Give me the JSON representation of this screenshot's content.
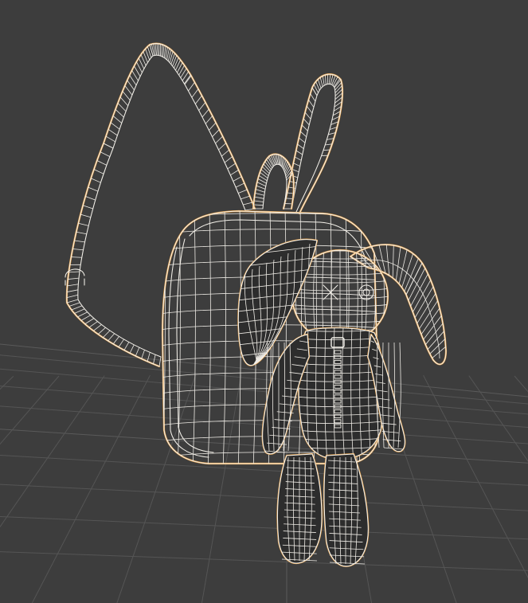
{
  "viewport": {
    "mode": "wireframe",
    "background_color": "#3d3d3d",
    "grid_color": "#555555",
    "selection_outline_color": "#e8a24a",
    "wire_color": "#f4f1ea"
  },
  "scene": {
    "objects": [
      "backpack-body",
      "shoulder-strap-left",
      "shoulder-strap-right",
      "top-handle",
      "bunny-plush",
      "strap-ring"
    ],
    "selected": true
  }
}
